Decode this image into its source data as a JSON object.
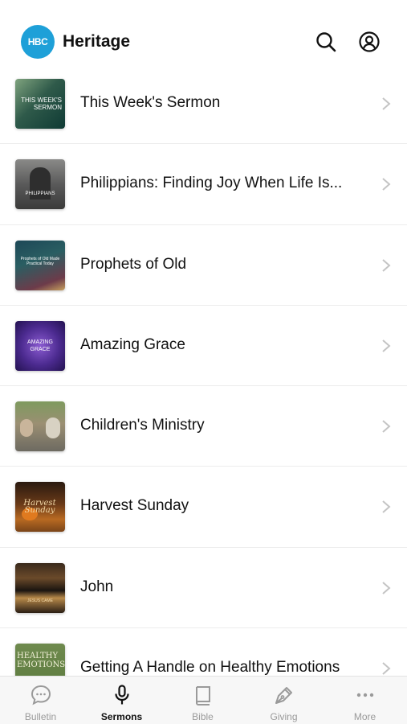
{
  "app": {
    "title": "Heritage",
    "logo_text": "HBC",
    "accent": "#1ea0d8"
  },
  "header": {
    "search_icon": "search-icon",
    "account_icon": "account-icon"
  },
  "sermons": [
    {
      "title": "This Week's Sermon",
      "thumb_caption": "This Week's Sermon"
    },
    {
      "title": "Philippians: Finding Joy When Life Is...",
      "thumb_caption": "Philippians"
    },
    {
      "title": "Prophets of Old",
      "thumb_caption": "Prophets of Old Made Practical Today"
    },
    {
      "title": "Amazing Grace",
      "thumb_caption": "Amazing Grace"
    },
    {
      "title": "Children's Ministry",
      "thumb_caption": ""
    },
    {
      "title": "Harvest Sunday",
      "thumb_caption": "Harvest Sunday"
    },
    {
      "title": "John",
      "thumb_caption": "Jesus Came"
    },
    {
      "title": "Getting A Handle on Healthy Emotions",
      "thumb_caption": "Healthy Emotions"
    }
  ],
  "tabs": [
    {
      "label": "Bulletin",
      "icon": "chat-bubble-icon",
      "active": false
    },
    {
      "label": "Sermons",
      "icon": "microphone-icon",
      "active": true
    },
    {
      "label": "Bible",
      "icon": "book-icon",
      "active": false
    },
    {
      "label": "Giving",
      "icon": "pen-icon",
      "active": false
    },
    {
      "label": "More",
      "icon": "more-dots-icon",
      "active": false
    }
  ]
}
